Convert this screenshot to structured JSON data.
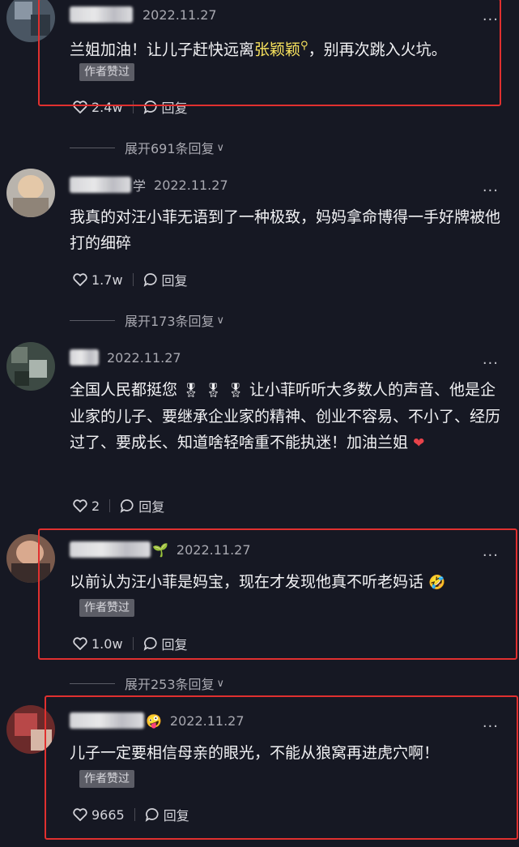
{
  "comments": [
    {
      "user_suffix": "",
      "date": "2022.11.27",
      "text_before": "兰姐加油！让儿子赶快远离",
      "keyword": "张颖颖",
      "text_after": "，别再次跳入火坑。",
      "liked_by_author": "作者赞过",
      "likes": "2.4w",
      "reply": "回复",
      "expand": "展开691条回复"
    },
    {
      "user_suffix": "学",
      "date": "2022.11.27",
      "text": "我真的对汪小菲无语到了一种极致，妈妈拿命博得一手好牌被他打的细碎",
      "likes": "1.7w",
      "reply": "回复",
      "expand": "展开173条回复"
    },
    {
      "user_suffix": "",
      "date": "2022.11.27",
      "text_part1": "全国人民都挺您",
      "text_part2": "让小菲听听大多数人的声音、他是企业家的儿子、要继承企业家的精神、创业不容易、不小了、经历过了、要成长、知道啥轻啥重不能执迷！加油兰姐",
      "likes": "2",
      "reply": "回复"
    },
    {
      "user_suffix": "",
      "date": "2022.11.27",
      "text": "以前认为汪小菲是妈宝，现在才发现他真不听老妈话",
      "liked_by_author": "作者赞过",
      "likes": "1.0w",
      "reply": "回复",
      "expand": "展开253条回复"
    },
    {
      "user_suffix": "",
      "date": "2022.11.27",
      "text": "儿子一定要相信母亲的眼光，不能从狼窝再进虎穴啊！",
      "liked_by_author": "作者赞过",
      "likes": "9665",
      "reply": "回复"
    }
  ],
  "colors": {
    "background": "#161823",
    "highlight_box": "#e0302f",
    "keyword": "#f8e25d"
  },
  "icons": [
    "heart-icon",
    "comment-bubble-icon",
    "search-icon",
    "chevron-down-icon",
    "more-icon"
  ]
}
